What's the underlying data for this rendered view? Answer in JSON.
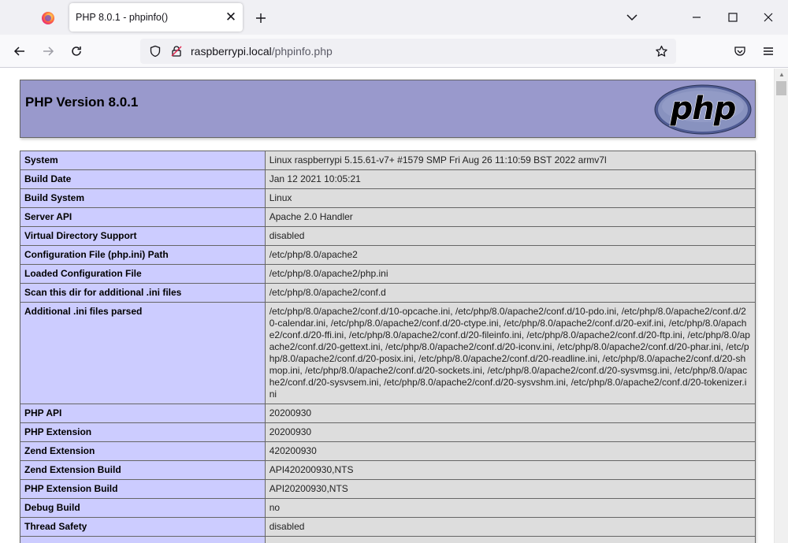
{
  "browser": {
    "tab_title": "PHP 8.0.1 - phpinfo()",
    "url_host": "raspberrypi.local",
    "url_path": "/phpinfo.php"
  },
  "page": {
    "version_title": "PHP Version 8.0.1",
    "logo_text": "php",
    "rows": [
      {
        "name": "System",
        "value": "Linux raspberrypi 5.15.61-v7+ #1579 SMP Fri Aug 26 11:10:59 BST 2022 armv7l"
      },
      {
        "name": "Build Date",
        "value": "Jan 12 2021 10:05:21"
      },
      {
        "name": "Build System",
        "value": "Linux"
      },
      {
        "name": "Server API",
        "value": "Apache 2.0 Handler"
      },
      {
        "name": "Virtual Directory Support",
        "value": "disabled"
      },
      {
        "name": "Configuration File (php.ini) Path",
        "value": "/etc/php/8.0/apache2"
      },
      {
        "name": "Loaded Configuration File",
        "value": "/etc/php/8.0/apache2/php.ini"
      },
      {
        "name": "Scan this dir for additional .ini files",
        "value": "/etc/php/8.0/apache2/conf.d"
      },
      {
        "name": "Additional .ini files parsed",
        "value": "/etc/php/8.0/apache2/conf.d/10-opcache.ini, /etc/php/8.0/apache2/conf.d/10-pdo.ini, /etc/php/8.0/apache2/conf.d/20-calendar.ini, /etc/php/8.0/apache2/conf.d/20-ctype.ini, /etc/php/8.0/apache2/conf.d/20-exif.ini, /etc/php/8.0/apache2/conf.d/20-ffi.ini, /etc/php/8.0/apache2/conf.d/20-fileinfo.ini, /etc/php/8.0/apache2/conf.d/20-ftp.ini, /etc/php/8.0/apache2/conf.d/20-gettext.ini, /etc/php/8.0/apache2/conf.d/20-iconv.ini, /etc/php/8.0/apache2/conf.d/20-phar.ini, /etc/php/8.0/apache2/conf.d/20-posix.ini, /etc/php/8.0/apache2/conf.d/20-readline.ini, /etc/php/8.0/apache2/conf.d/20-shmop.ini, /etc/php/8.0/apache2/conf.d/20-sockets.ini, /etc/php/8.0/apache2/conf.d/20-sysvmsg.ini, /etc/php/8.0/apache2/conf.d/20-sysvsem.ini, /etc/php/8.0/apache2/conf.d/20-sysvshm.ini, /etc/php/8.0/apache2/conf.d/20-tokenizer.ini"
      },
      {
        "name": "PHP API",
        "value": "20200930"
      },
      {
        "name": "PHP Extension",
        "value": "20200930"
      },
      {
        "name": "Zend Extension",
        "value": "420200930"
      },
      {
        "name": "Zend Extension Build",
        "value": "API420200930,NTS"
      },
      {
        "name": "PHP Extension Build",
        "value": "API20200930,NTS"
      },
      {
        "name": "Debug Build",
        "value": "no"
      },
      {
        "name": "Thread Safety",
        "value": "disabled"
      },
      {
        "name": "",
        "value": ""
      }
    ]
  },
  "colors": {
    "header_bg": "#9999cc",
    "key_bg": "#ccccff",
    "value_bg": "#dddddd"
  }
}
